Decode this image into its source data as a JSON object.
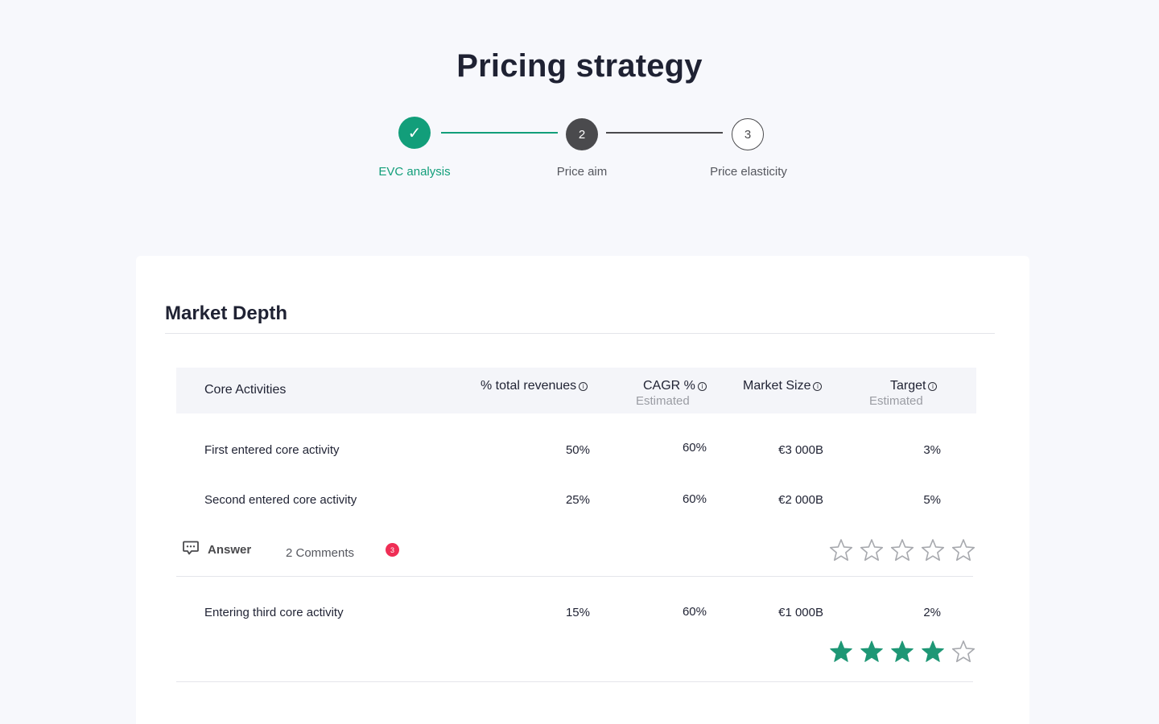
{
  "page": {
    "title": "Pricing strategy"
  },
  "stepper": {
    "steps": [
      {
        "number": "✓",
        "label": "EVC analysis",
        "status": "completed"
      },
      {
        "number": "2",
        "label": "Price aim",
        "status": "current"
      },
      {
        "number": "3",
        "label": "Price elasticity",
        "status": "upcoming"
      }
    ]
  },
  "section": {
    "title": "Market Depth",
    "columns": {
      "activity": "Core Activities",
      "revenues": "% total revenues",
      "cagr": "CAGR %",
      "cagr_sub": "Estimated",
      "market_size": "Market Size",
      "target": "Target",
      "target_sub": "Estimated",
      "info_glyph": "i"
    },
    "rows": [
      {
        "activity": "First entered core activity",
        "revenues": "50%",
        "cagr": "60%",
        "market_size": "€3 000B",
        "target": "3%"
      },
      {
        "activity": "Second entered core activity",
        "revenues": "25%",
        "cagr": "60%",
        "market_size": "€2 000B",
        "target": "5%"
      },
      {
        "activity": "Entering third core activity",
        "revenues": "15%",
        "cagr": "60%",
        "market_size": "€1 000B",
        "target": "2%"
      }
    ],
    "answer_bar": {
      "answer_label": "Answer",
      "comments_label": "2 Comments",
      "badge_count": "3",
      "badge_color": "#ef2e55"
    },
    "ratings": [
      {
        "value": 0,
        "max": 5
      },
      {
        "value": 4,
        "max": 5
      }
    ]
  },
  "colors": {
    "accent": "#129e7a",
    "star_filled": "#1e9775",
    "star_empty": "#a7a9ae"
  }
}
